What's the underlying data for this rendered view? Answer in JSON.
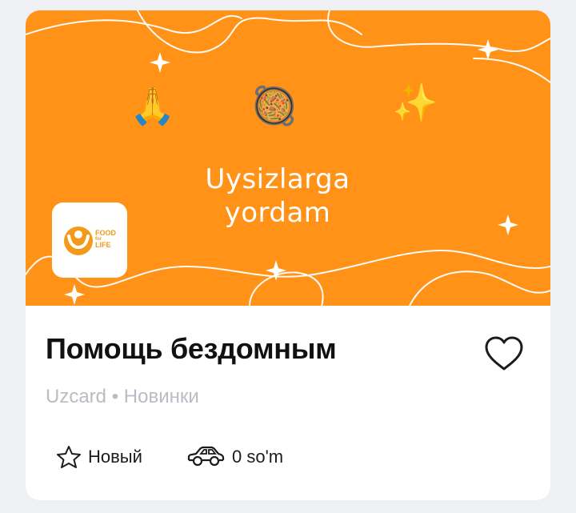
{
  "banner": {
    "emojis": {
      "hands": "🙏",
      "dish": "🥘",
      "sparkles": "✨"
    },
    "title_line1": "Uysizlarga",
    "title_line2": "yordam",
    "logo": {
      "text_line1": "FOOD",
      "text_line2": "for",
      "text_line3": "LIFE"
    }
  },
  "card": {
    "title": "Помощь бездомным",
    "subtitle": "Uzcard • Новинки",
    "status_label": "Новый",
    "price_label": "0 so'm"
  },
  "colors": {
    "banner_bg": "#ff9217",
    "card_bg": "#ffffff",
    "page_bg": "#eff0f4",
    "subtitle": "#b9bcc4"
  },
  "icons": [
    "star-outline-icon",
    "car-icon",
    "heart-outline-icon"
  ]
}
